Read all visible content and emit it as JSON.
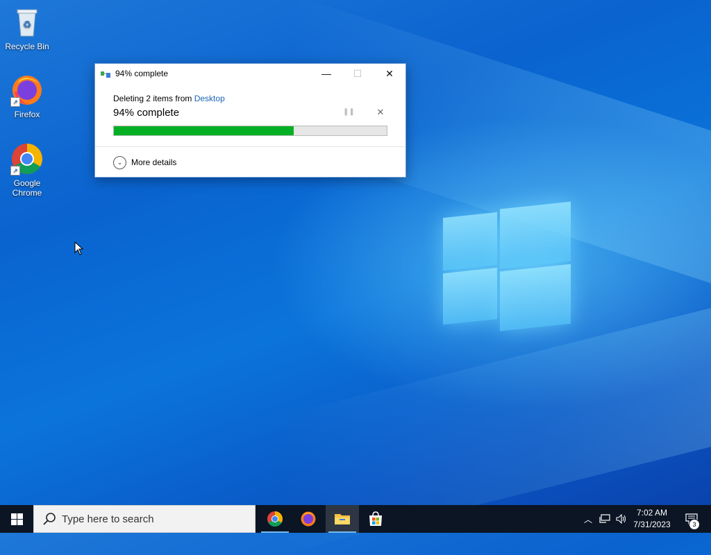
{
  "desktop": {
    "icons": [
      {
        "label": "Recycle Bin"
      },
      {
        "label": "Firefox"
      },
      {
        "label": "Google Chrome"
      }
    ]
  },
  "dialog": {
    "title": "94% complete",
    "deleting_prefix": "Deleting 2 items from",
    "deleting_location": "Desktop",
    "percent_text": "94% complete",
    "progress_fraction": 0.66,
    "more_details": "More details",
    "controls": {
      "minimize": "—",
      "maximize": "☐",
      "close": "✕"
    }
  },
  "taskbar": {
    "search_placeholder": "Type here to search",
    "apps": [
      "chrome-icon",
      "firefox-icon",
      "file-explorer-icon",
      "store-icon"
    ],
    "active_app": "file-explorer",
    "clock": {
      "time": "7:02 AM",
      "date": "7/31/2023"
    },
    "notification_count": "3"
  },
  "colors": {
    "progress_fill": "#06b025",
    "link": "#1a63b8",
    "taskbar": "#0b1524"
  }
}
